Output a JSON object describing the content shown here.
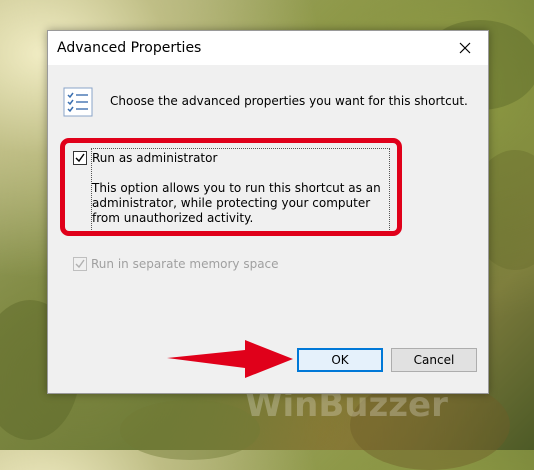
{
  "dialog": {
    "title": "Advanced Properties",
    "header_text": "Choose the advanced properties you want for this shortcut.",
    "run_as_admin": {
      "label": "Run as administrator",
      "checked": true,
      "description": "This option allows you to run this shortcut as an administrator, while protecting your computer from unauthorized activity."
    },
    "separate_memory": {
      "label": "Run in separate memory space",
      "checked": true,
      "enabled": false
    },
    "buttons": {
      "ok": "OK",
      "cancel": "Cancel"
    }
  },
  "icons": [
    "checklist-icon",
    "close-icon",
    "checkmark-icon",
    "arrow-icon"
  ],
  "colors": {
    "highlight": "#e0001a",
    "accent": "#0078d7"
  }
}
